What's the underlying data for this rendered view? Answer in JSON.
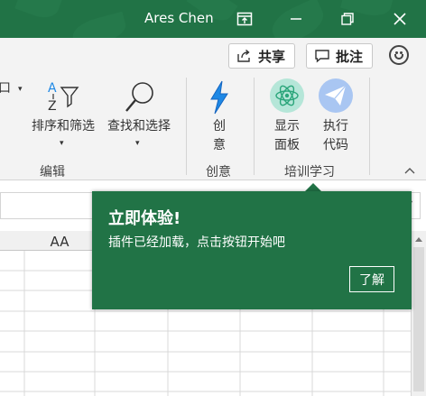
{
  "titlebar": {
    "user_name": "Ares Chen",
    "colors": {
      "bg": "#217346",
      "text": "#ffffff"
    },
    "icons": [
      "ribbon-display-icon",
      "minimize-icon",
      "restore-icon",
      "close-icon"
    ]
  },
  "share_row": {
    "share_label": "共享",
    "comments_label": "批注",
    "icons": [
      "share-icon",
      "comment-icon",
      "feedback-smiley-icon"
    ]
  },
  "ribbon": {
    "partial_label": "口",
    "sort_filter": {
      "label": "排序和筛选",
      "icon": "sort-filter-icon"
    },
    "find_select": {
      "label": "查找和选择",
      "icon": "search-icon"
    },
    "editing_group": "编辑",
    "creative": {
      "label_line1": "创",
      "label_line2": "意",
      "icon": "lightning-icon"
    },
    "creative_group": "创意",
    "display_panel": {
      "label_line1": "显示",
      "label_line2": "面板",
      "icon": "atom-icon"
    },
    "run_code": {
      "label_line1": "执行",
      "label_line2": "代码",
      "icon": "paper-plane-icon"
    },
    "training_group": "培训学习",
    "colors": {
      "accent_blue": "#1e88e5",
      "atom_bg": "#b5e6d8",
      "plane_bg": "#a9c6f2"
    }
  },
  "sheet": {
    "column_header": "AA"
  },
  "popup": {
    "title": "立即体验!",
    "body": "插件已经加载，点击按钮开始吧",
    "button_label": "了解",
    "colors": {
      "bg": "#217346"
    }
  }
}
